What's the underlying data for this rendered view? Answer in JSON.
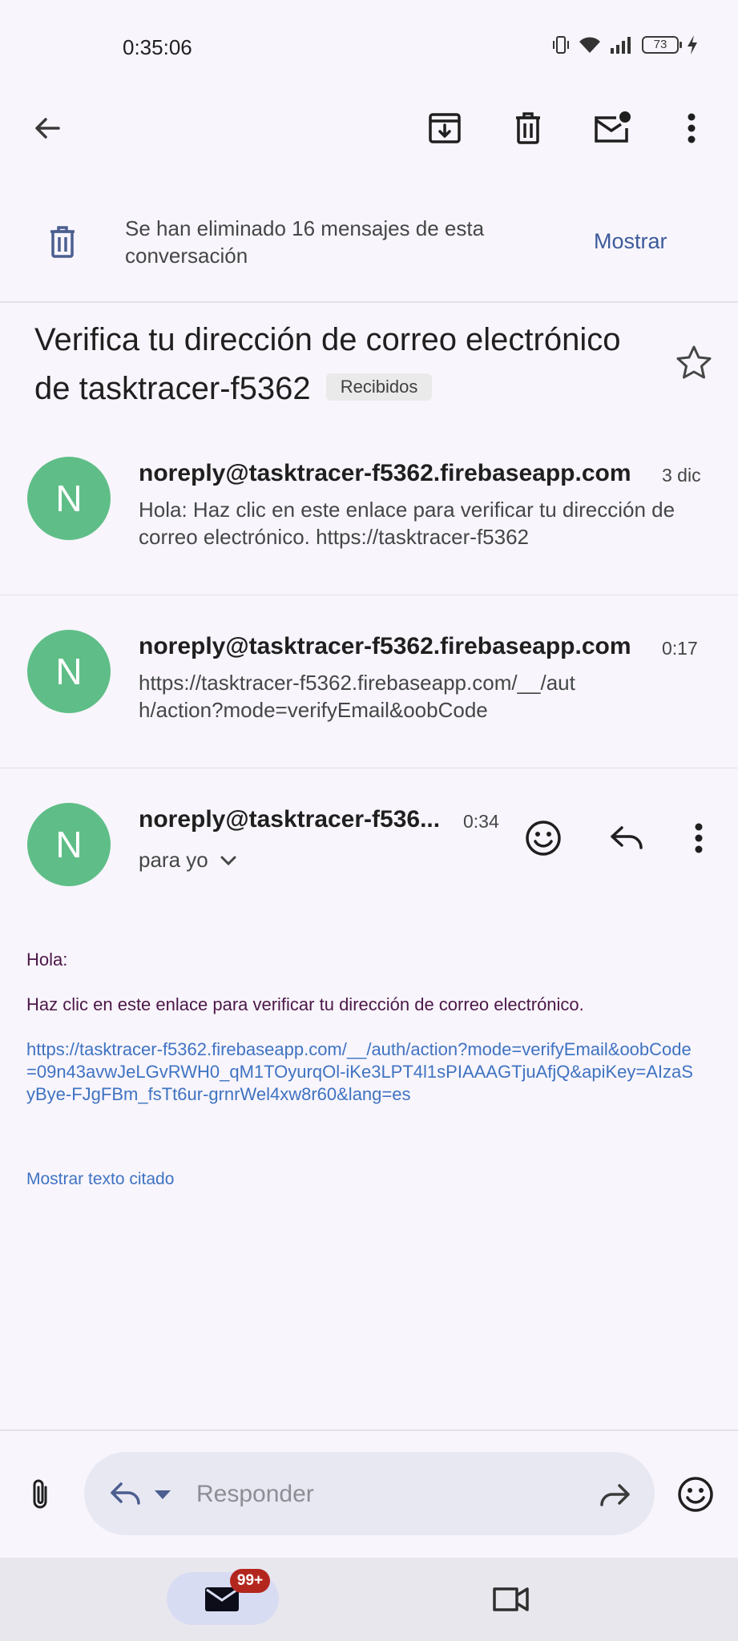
{
  "status_bar": {
    "time": "0:35:06",
    "battery": "73"
  },
  "banner": {
    "text": "Se han eliminado 16 mensajes de esta conversación",
    "action": "Mostrar"
  },
  "subject": {
    "title": "Verifica tu dirección de correo electrónico de tasktracer-f5362",
    "label": "Recibidos"
  },
  "messages": [
    {
      "avatar": "N",
      "sender": "noreply@tasktracer-f5362.firebaseapp.com",
      "date": "3 dic",
      "snippet": "Hola: Haz clic en este enlace para verificar tu dirección de correo electrónico. https://tasktracer-f5362"
    },
    {
      "avatar": "N",
      "sender": "noreply@tasktracer-f5362.firebaseapp.com",
      "date": "0:17",
      "snippet": "https://tasktracer-f5362.firebaseapp.com/__/auth/action?mode=verifyEmail&oobCode"
    },
    {
      "avatar": "N",
      "sender": "noreply@tasktracer-f536...",
      "date": "0:34",
      "recipient": "para yo"
    }
  ],
  "body": {
    "greeting": "Hola:",
    "instruction": "Haz clic en este enlace para verificar tu dirección de correo electrónico.",
    "link": "https://tasktracer-f5362.firebaseapp.com/__/auth/action?mode=verifyEmail&oobCode=09n43avwJeLGvRWH0_qM1TOyurqOl-iKe3LPT4l1sPIAAAGTjuAfjQ&apiKey=AIzaSyBye-FJgFBm_fsTt6ur-grnrWel4xw8r60&lang=es",
    "quoted_toggle": "Mostrar texto citado"
  },
  "reply_bar": {
    "placeholder": "Responder"
  },
  "bottom_nav": {
    "mail_badge": "99+"
  },
  "colors": {
    "avatar": "#5fbe87",
    "link": "#3f73c2",
    "body_text": "#4c1748",
    "badge": "#b3261e"
  }
}
